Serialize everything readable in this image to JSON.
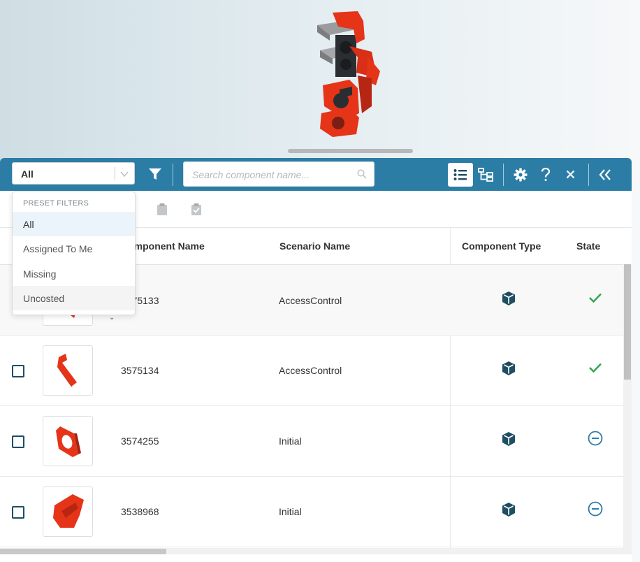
{
  "toolbar": {
    "filter_value": "All",
    "search_placeholder": "Search component name..."
  },
  "dropdown": {
    "header": "PRESET FILTERS",
    "items": [
      "All",
      "Assigned To Me",
      "Missing",
      "Uncosted"
    ],
    "selected": "All"
  },
  "table": {
    "headers": {
      "component_name": "Component Name",
      "scenario_name": "Scenario Name",
      "component_type": "Component Type",
      "state": "State"
    },
    "rows": [
      {
        "component": "3575133",
        "scenario": "AccessControl",
        "type": "part-cube-icon",
        "state": "complete"
      },
      {
        "component": "3575134",
        "scenario": "AccessControl",
        "type": "part-cube-icon",
        "state": "complete"
      },
      {
        "component": "3574255",
        "scenario": "Initial",
        "type": "part-cube-icon",
        "state": "not-costed"
      },
      {
        "component": "3538968",
        "scenario": "Initial",
        "type": "part-cube-icon",
        "state": "not-costed"
      }
    ]
  },
  "colors": {
    "toolbar": "#2c7da5",
    "accent_dark": "#1f4e63",
    "success": "#2ea44f",
    "neutral_state": "#2c7da5",
    "part_red": "#e53418"
  }
}
